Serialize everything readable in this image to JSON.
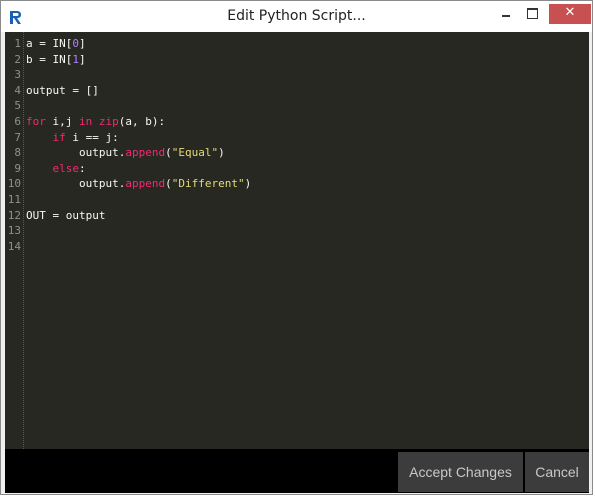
{
  "window": {
    "title": "Edit Python Script..."
  },
  "titlebar_controls": {
    "minimize": "–",
    "maximize": "□",
    "close": "X"
  },
  "editor": {
    "line_numbers": [
      "1",
      "2",
      "3",
      "4",
      "5",
      "6",
      "7",
      "8",
      "9",
      "10",
      "11",
      "12",
      "13",
      "14"
    ],
    "lines": [
      "a = IN[0]",
      "b = IN[1]",
      "",
      "output = []",
      "",
      "for i,j in zip(a, b):",
      "    if i == j:",
      "        output.append(\"Equal\")",
      "    else:",
      "        output.append(\"Different\")",
      "",
      "OUT = output",
      "",
      ""
    ]
  },
  "footer": {
    "accept_label": "Accept Changes",
    "cancel_label": "Cancel"
  },
  "colors": {
    "editor_background": "#272822",
    "keyword": "#f92672",
    "number": "#ae81ff",
    "string": "#e6db74",
    "text": "#f8f8f2",
    "line_number": "#8f908a",
    "button_background": "#3c3c3c"
  }
}
